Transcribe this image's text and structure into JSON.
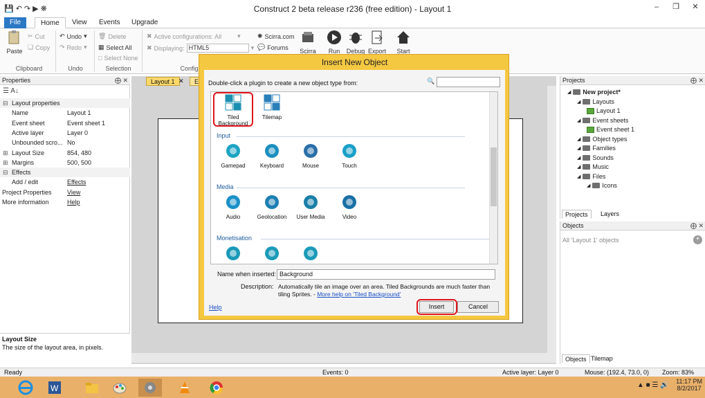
{
  "app": {
    "title": "Construct 2 beta release r236  (free edition) - Layout 1",
    "window_buttons": [
      "–",
      "❒",
      "✕"
    ]
  },
  "ribbon": {
    "tabs": [
      "File",
      "Home",
      "View",
      "Events",
      "Upgrade"
    ],
    "active_tab": "Home",
    "clipboard": {
      "paste": "Paste",
      "cut": "Cut",
      "copy": "Copy",
      "label": "Clipboard"
    },
    "undo": {
      "undo": "Undo",
      "redo": "Redo",
      "label": "Undo"
    },
    "selection": {
      "delete": "Delete",
      "select_all": "Select All",
      "select_none": "Select None",
      "label": "Selection"
    },
    "config": {
      "active": "Active configurations: All",
      "displaying_label": "Displaying:",
      "displaying_value": "HTML5",
      "label": "Configu"
    },
    "links": {
      "scirra": "Scirra.com",
      "forums": "Forums"
    },
    "big_buttons": [
      "Scirra",
      "Run",
      "Debug",
      "Export",
      "Start"
    ]
  },
  "properties": {
    "title": "Properties",
    "rows": [
      {
        "type": "cat",
        "toggle": "⊟",
        "key": "Layout properties"
      },
      {
        "key": "Name",
        "value": "Layout 1"
      },
      {
        "key": "Event sheet",
        "value": "Event sheet 1"
      },
      {
        "key": "Active layer",
        "value": "Layer 0"
      },
      {
        "key": "Unbounded scro...",
        "value": "No"
      },
      {
        "type": "exp",
        "toggle": "⊞",
        "key": "Layout Size",
        "value": "854, 480"
      },
      {
        "type": "exp",
        "toggle": "⊞",
        "key": "Margins",
        "value": "500, 500"
      },
      {
        "type": "cat",
        "toggle": "⊟",
        "key": "Effects"
      },
      {
        "key": "Add / edit",
        "value": "Effects",
        "link": true
      },
      {
        "type": "plain",
        "key": "Project Properties",
        "value": "View",
        "link": true
      },
      {
        "type": "plain",
        "key": "More information",
        "value": "Help",
        "link": true
      }
    ],
    "desc_title": "Layout Size",
    "desc_text": "The size of the layout area, in pixels."
  },
  "doc_tabs": [
    "Layout 1",
    "E"
  ],
  "projects": {
    "title": "Projects",
    "tree": [
      {
        "label": "New project*",
        "level": 0,
        "bold": true,
        "icon": "folder"
      },
      {
        "label": "Layouts",
        "level": 1,
        "icon": "folder"
      },
      {
        "label": "Layout 1",
        "level": 2,
        "icon": "leaf"
      },
      {
        "label": "Event sheets",
        "level": 1,
        "icon": "folder"
      },
      {
        "label": "Event sheet 1",
        "level": 2,
        "icon": "leaf"
      },
      {
        "label": "Object types",
        "level": 1,
        "icon": "folder"
      },
      {
        "label": "Families",
        "level": 1,
        "icon": "folder"
      },
      {
        "label": "Sounds",
        "level": 1,
        "icon": "folder"
      },
      {
        "label": "Music",
        "level": 1,
        "icon": "folder"
      },
      {
        "label": "Files",
        "level": 1,
        "icon": "folder"
      },
      {
        "label": "Icons",
        "level": 2,
        "icon": "folder"
      }
    ],
    "tabs": [
      "Projects",
      "Layers"
    ]
  },
  "objects": {
    "title": "Objects",
    "filter": "All 'Layout 1' objects",
    "tabs": [
      "Objects",
      "Tilemap"
    ]
  },
  "status": {
    "ready": "Ready",
    "events": "Events: 0",
    "active_layer": "Active layer: Layer 0",
    "mouse": "Mouse: (192.4, 73.0, 0)",
    "zoom": "Zoom: 83%"
  },
  "taskbar": {
    "apps": [
      "ie",
      "word",
      "explorer",
      "paint",
      "settings",
      "vlc",
      "chrome"
    ],
    "time": "11:17 PM",
    "date": "8/2/2017"
  },
  "dialog": {
    "title": "Insert New Object",
    "hint": "Double-click a plugin to create a new object type from:",
    "search_value": "",
    "categories": [
      {
        "name": "",
        "plugins": [
          "Tiled Background",
          "Tilemap"
        ]
      },
      {
        "name": "Input",
        "plugins": [
          "Gamepad",
          "Keyboard",
          "Mouse",
          "Touch"
        ]
      },
      {
        "name": "Media",
        "plugins": [
          "Audio",
          "Geolocation",
          "User Media",
          "Video"
        ]
      },
      {
        "name": "Monetisation",
        "plugins": [
          "",
          "",
          ""
        ]
      }
    ],
    "name_label": "Name when inserted:",
    "name_value": "Background",
    "description_label": "Description:",
    "description": "Automatically tile an image over an area.  Tiled Backgrounds are much faster than tiling Sprites. - ",
    "description_link": "More help on 'Tiled Background'",
    "help": "Help",
    "insert": "Insert",
    "cancel": "Cancel"
  }
}
